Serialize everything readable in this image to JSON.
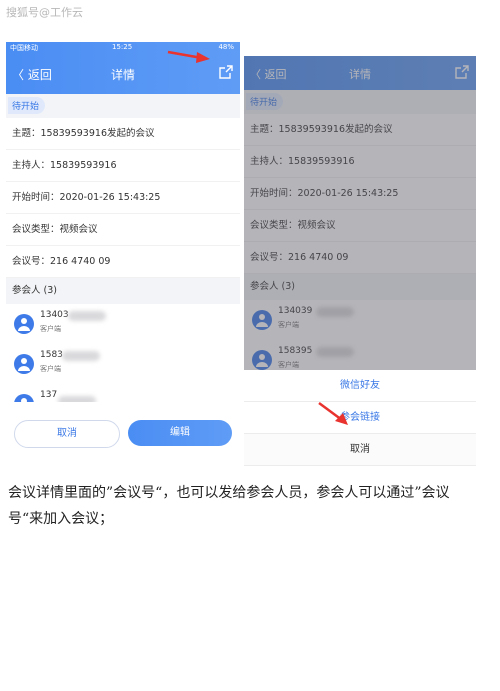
{
  "watermark": "搜狐号@工作云",
  "left_phone": {
    "status": {
      "carrier": "中国移动",
      "time": "15:25",
      "battery": "48%"
    },
    "nav": {
      "back": "〈 返回",
      "title": "详情"
    },
    "status_pill": "待开始",
    "fields": [
      "主题：15839593916发起的会议",
      "主持人：15839593916",
      "开始时间：2020-01-26 15:43:25",
      "会议类型：视频会议",
      "会议号：216 4740 09"
    ],
    "attendees_header": "参会人 (3)",
    "attendees": [
      {
        "phone": "13403",
        "role": "客户端"
      },
      {
        "phone": "1583",
        "role": "客户端"
      },
      {
        "phone": "137",
        "role": "客户端"
      }
    ],
    "buttons": {
      "cancel": "取消",
      "edit": "编辑"
    }
  },
  "right_phone": {
    "nav": {
      "back": "〈 返回",
      "title": "详情"
    },
    "status_pill": "待开始",
    "fields": [
      "主题：15839593916发起的会议",
      "主持人：15839593916",
      "开始时间：2020-01-26 15:43:25",
      "会议类型：视频会议",
      "会议号：216 4740 09"
    ],
    "attendees_header": "参会人 (3)",
    "attendees": [
      {
        "phone": "134039",
        "role": "客户端"
      },
      {
        "phone": "158395",
        "role": "客户端"
      }
    ],
    "share_sheet": {
      "wechat": "微信好友",
      "link": "参会链接",
      "cancel": "取消"
    }
  },
  "caption": "会议详情里面的”会议号“，也可以发给参会人员，参会人可以通过”会议号“来加入会议；",
  "colors": {
    "brand_blue": "#4a8df3",
    "arrow_red": "#e8332e"
  }
}
